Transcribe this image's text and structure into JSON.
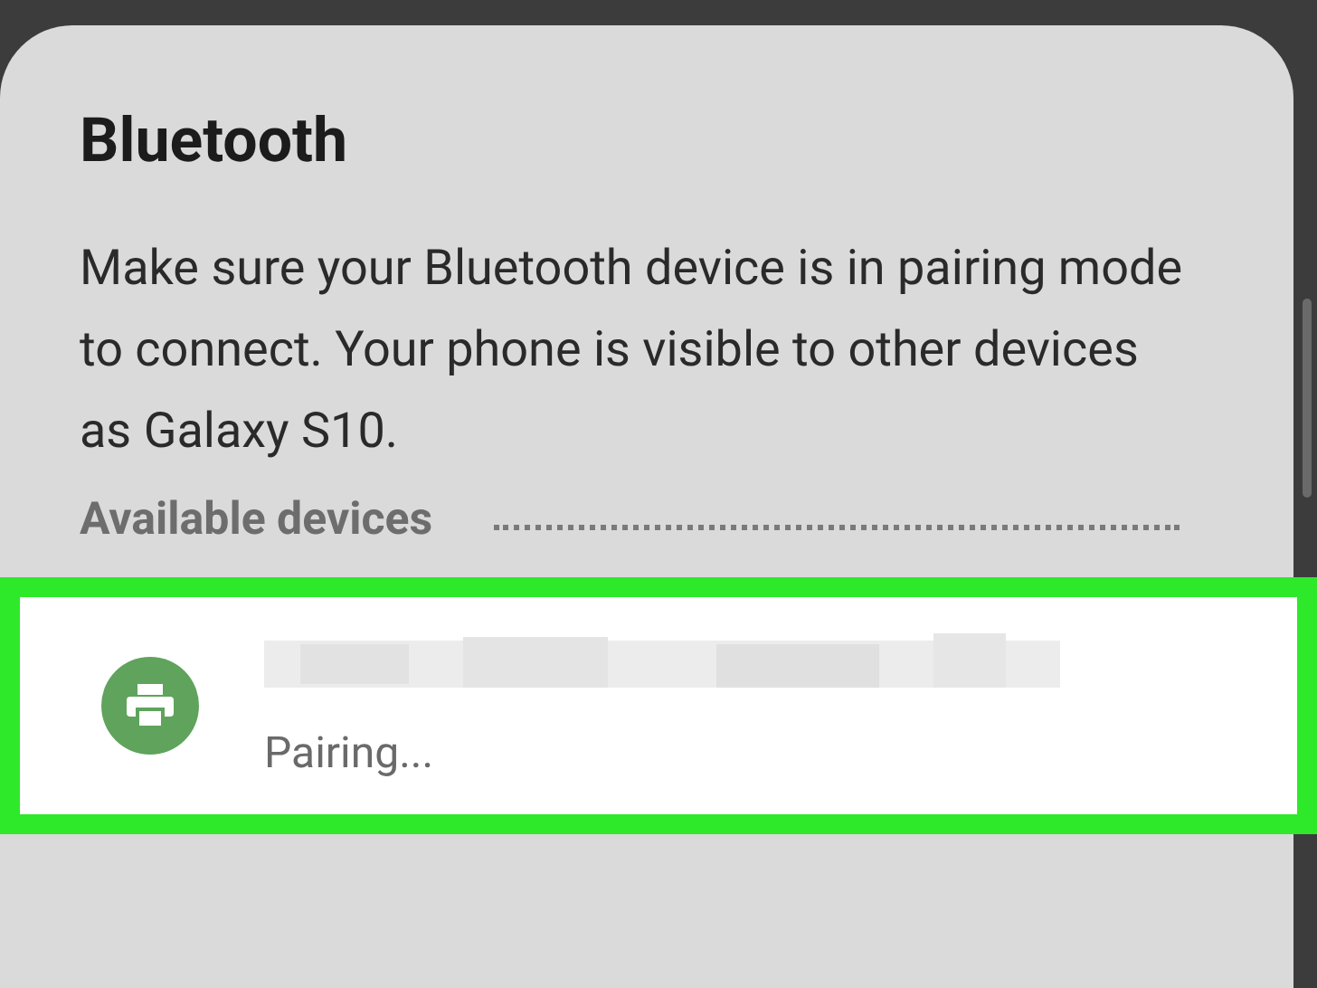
{
  "title": "Bluetooth",
  "description": "Make sure your Bluetooth device is in pairing mode to connect. Your phone is visible to other devices as Galaxy S10.",
  "section": {
    "label": "Available devices",
    "loading": true
  },
  "devices": [
    {
      "status": "Pairing...",
      "highlighted": true
    }
  ]
}
